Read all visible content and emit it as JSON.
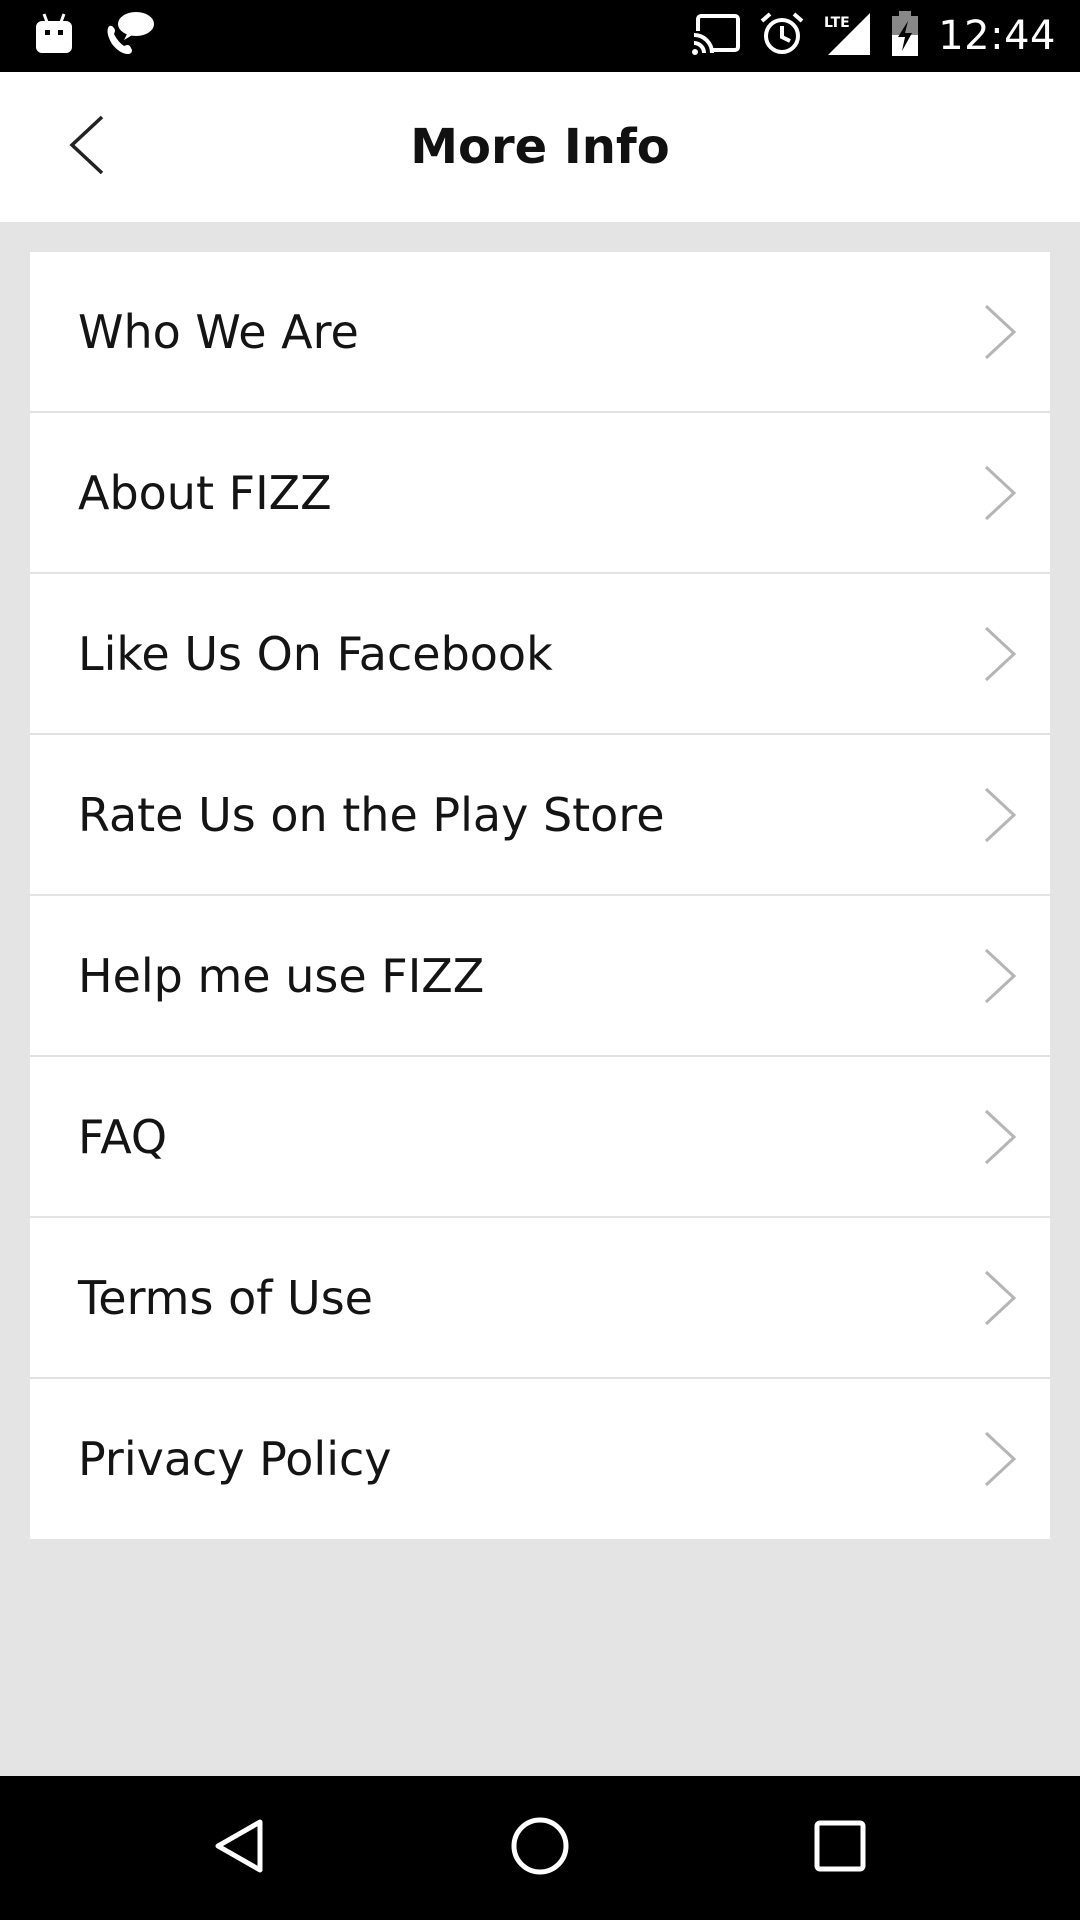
{
  "status_bar": {
    "time": "12:44",
    "icons": [
      "android-icon",
      "voice-chat-icon",
      "cast-icon",
      "alarm-icon",
      "lte-signal-icon",
      "battery-charging-icon"
    ]
  },
  "app_bar": {
    "title": "More Info",
    "back_icon": "back-chevron-icon"
  },
  "menu": {
    "items": [
      {
        "label": "Who We Are"
      },
      {
        "label": "About FIZZ"
      },
      {
        "label": "Like Us On Facebook"
      },
      {
        "label": "Rate Us on the Play Store"
      },
      {
        "label": "Help me use FIZZ"
      },
      {
        "label": "FAQ"
      },
      {
        "label": "Terms of Use"
      },
      {
        "label": "Privacy Policy"
      }
    ]
  },
  "nav_bar": {
    "buttons": [
      "back-triangle-icon",
      "home-circle-icon",
      "recents-square-icon"
    ]
  },
  "colors": {
    "background": "#e4e4e4",
    "card": "#ffffff",
    "text": "#141414",
    "divider": "#e2e2e2",
    "chevron": "#b5b5b5"
  }
}
